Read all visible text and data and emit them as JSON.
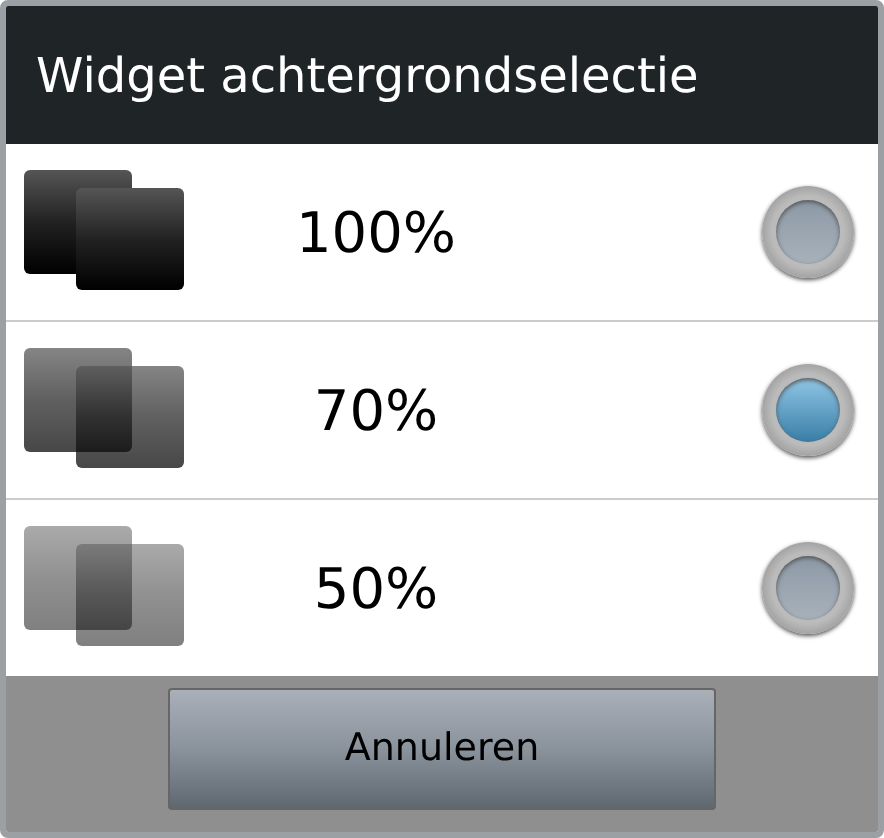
{
  "dialog": {
    "title": "Widget achtergrondselectie"
  },
  "options": [
    {
      "label": "100%",
      "selected": false
    },
    {
      "label": "70%",
      "selected": true
    },
    {
      "label": "50%",
      "selected": false
    }
  ],
  "buttons": [
    "Annuleren"
  ]
}
